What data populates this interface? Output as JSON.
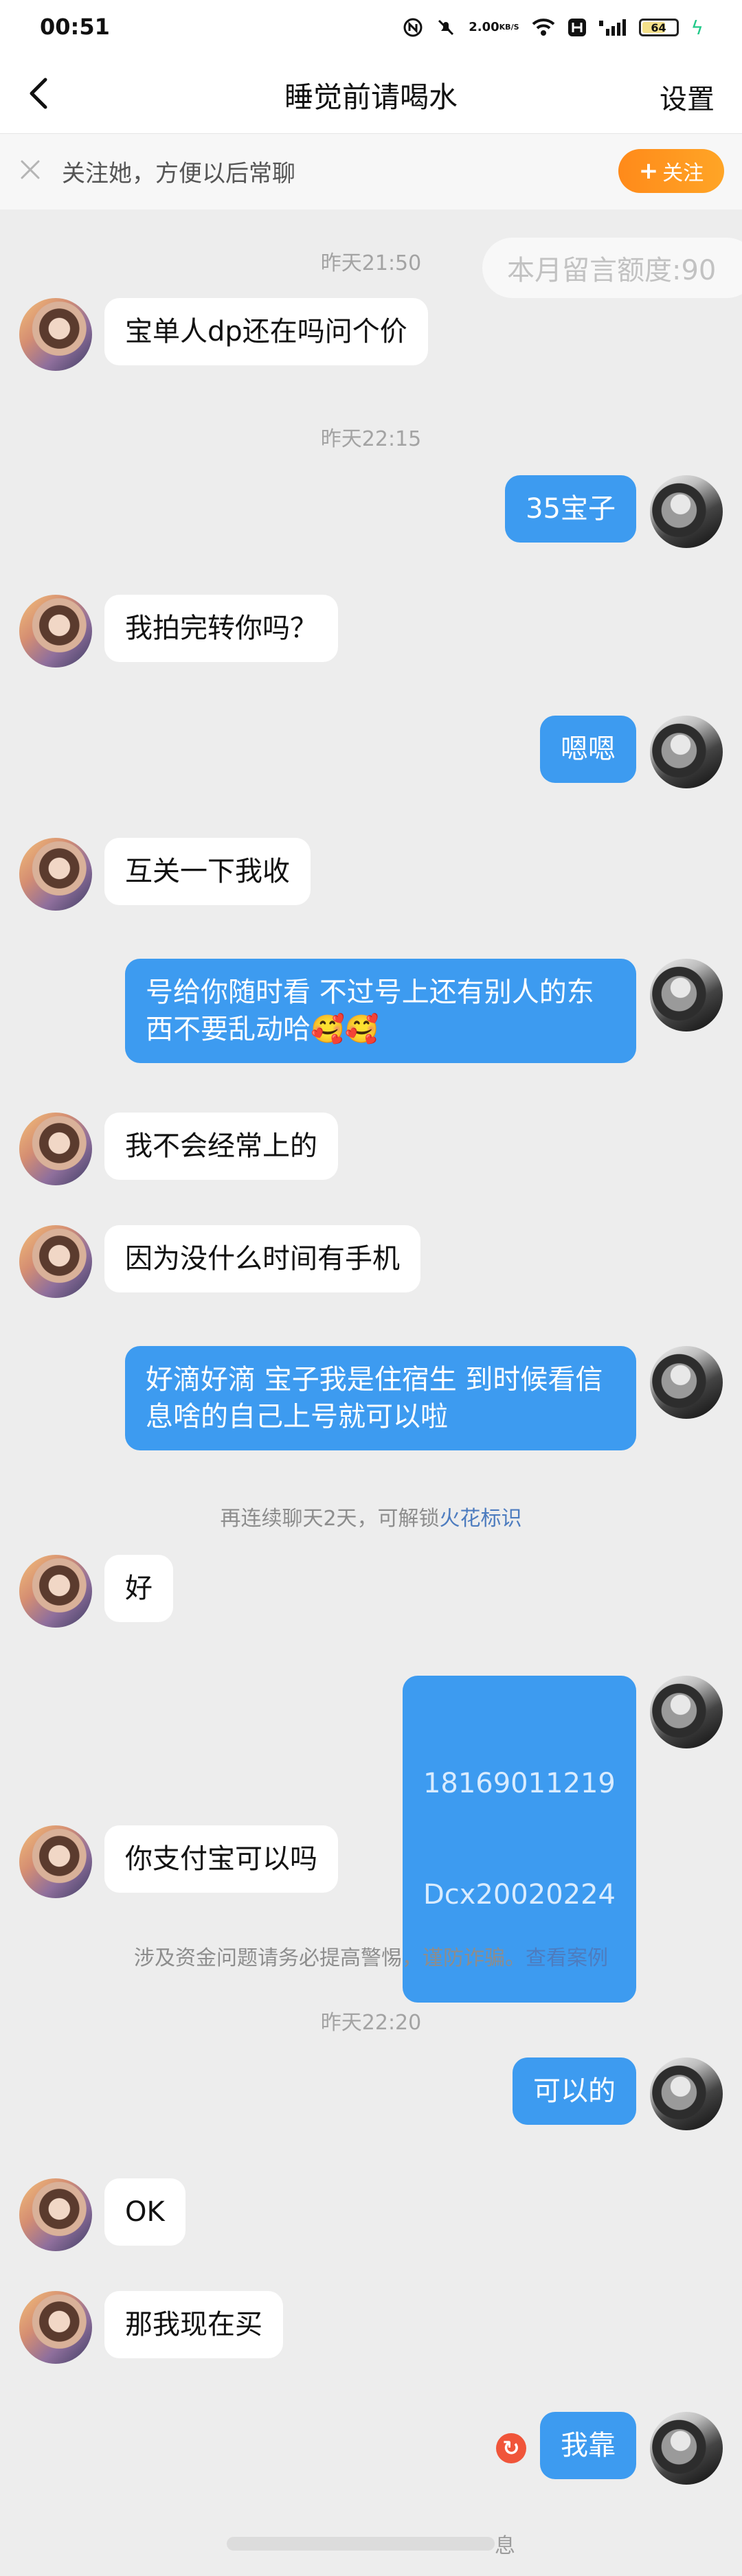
{
  "status_bar": {
    "time": "00:51",
    "net_speed": "2.00",
    "net_unit": "KB/S",
    "battery": "64"
  },
  "nav": {
    "title": "睡觉前请喝水",
    "settings": "设置"
  },
  "follow_bar": {
    "text": "关注她，方便以后常聊",
    "button": "关注"
  },
  "quota": "本月留言额度:90",
  "timestamps": [
    "昨天21:50",
    "昨天22:15",
    "昨天22:20"
  ],
  "system": {
    "streak": "再连续聊天2天，可解锁",
    "streak_link": "火花标识",
    "warning": "涉及资金问题请务必提高警惕，谨防诈骗。",
    "warning_link": "查看案例"
  },
  "messages": {
    "m1": "宝单人dp还在吗问个价",
    "m2": "35宝子",
    "m3": "我拍完转你吗？",
    "m4": "嗯嗯",
    "m5": "互关一下我收",
    "m6": "号给你随时看 不过号上还有别人的东西不要乱动哈🥰🥰",
    "m7": "我不会经常上的",
    "m8": "因为没什么时间有手机",
    "m9": "好滴好滴 宝子我是住宿生 到时候看信息啥的自己上号就可以啦",
    "m10": "好",
    "m11_line1": "18169011219",
    "m11_line2": "Dcx20020224",
    "m12": "你支付宝可以吗",
    "m13": "可以的",
    "m14": "OK",
    "m15": "那我现在买",
    "m16": "我靠"
  },
  "bottom_hint": "息"
}
